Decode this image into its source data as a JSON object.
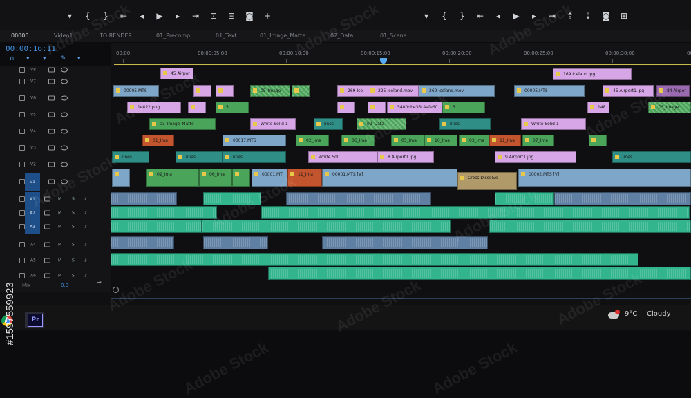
{
  "transport_left": [
    "marker-icon",
    "in-point-icon",
    "out-point-icon",
    "go-to-in-icon",
    "step-back-icon",
    "play-icon",
    "step-forward-icon",
    "go-to-out-icon",
    "insert-icon",
    "overwrite-icon",
    "export-frame-icon",
    "add-icon"
  ],
  "transport_right": [
    "marker-icon",
    "in-point-icon",
    "out-point-icon",
    "go-to-in-icon",
    "step-back-icon",
    "play-icon",
    "step-forward-icon",
    "go-to-out-icon",
    "lift-icon",
    "extract-icon",
    "export-frame-icon",
    "compare-icon"
  ],
  "tabs": [
    "00000",
    "Video1",
    "TO RENDER",
    "01_Precomp",
    "01_Text",
    "01_Image_Matte",
    "02_Data",
    "01_Scene"
  ],
  "timecode": "00:00:16:11",
  "ruler": [
    "00:00",
    "00:00:05:00",
    "00:00:10:00",
    "00:00:15:00",
    "00:00:20:00",
    "00:00:25:00",
    "00:00:30:00",
    "00:00:35"
  ],
  "video_tracks": [
    "V8",
    "V7",
    "V6",
    "V5",
    "V4",
    "V3",
    "V2",
    "V1"
  ],
  "audio_tracks": [
    "A1",
    "A2",
    "A3",
    "A4",
    "A5",
    "A6"
  ],
  "track_letters": {
    "m": "M",
    "s": "S"
  },
  "mix_label": "Mix",
  "mix_value": "0.0",
  "clips": {
    "v7": [
      "45 Airpor",
      "169 Iceland.jpg"
    ],
    "v6": [
      "00005.MTS",
      "05_Image",
      "269 Ice",
      "225 Iceland.mov",
      "269 Iceland.mov",
      "00005.MTS",
      "45 Airport1.jpg",
      "84 Airpor"
    ],
    "v5": [
      "1e822.png",
      "5",
      "5400dbe36c4afe60",
      "5",
      "148",
      "05_Image"
    ],
    "v4": [
      "03_Image_Matte",
      "White Solid 1",
      "lines",
      "02_Data",
      "lines",
      "White Solid 1"
    ],
    "v3": [
      "01_Ima",
      "00017.MTS",
      "02_Ima",
      "06_Ima",
      "05_Ima",
      "10_Ima",
      "03_Ima",
      "11_Ima",
      "07_Ima"
    ],
    "v2": [
      "lines",
      "lines",
      "lines",
      "White Soli",
      "8 Airport1.jpg",
      "9 Airport1.jpg",
      "lines"
    ],
    "v1": [
      "02_Ima",
      "06_Ima",
      "00001.MT",
      "11_Ima",
      "00001.MTS [V]",
      "Cross Dissolve",
      "00002.MTS [V]"
    ]
  },
  "taskbar": {
    "apps": [
      "chrome-icon",
      "premiere-pro-icon"
    ],
    "premiere_label": "Pr",
    "weather_temp": "9°C",
    "weather_text": "Cloudy"
  },
  "watermark": {
    "text": "Adobe Stock",
    "id": "#1597559923"
  },
  "colors": {
    "accent": "#3b8fe0",
    "pink": "#d7a6e6",
    "teal": "#2f8f86",
    "green": "#4aa55a",
    "blue": "#7ea6c8",
    "orange": "#c2552e",
    "audio_green": "#32b48c",
    "audio_blue": "#5f7fa3"
  }
}
